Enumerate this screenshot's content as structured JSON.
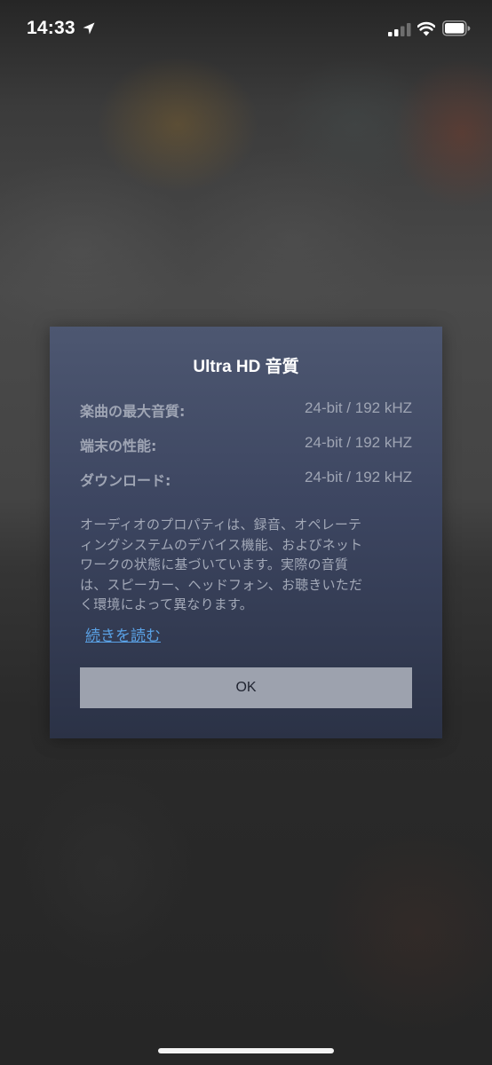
{
  "status_bar": {
    "time": "14:33",
    "icons": [
      "location-arrow-icon",
      "cellular-signal-icon",
      "wifi-icon",
      "battery-icon"
    ]
  },
  "modal": {
    "title": "Ultra HD 音質",
    "specs": [
      {
        "label": "楽曲の最大音質:",
        "value": "24-bit / 192 kHZ"
      },
      {
        "label": "端末の性能:",
        "value": "24-bit / 192 kHZ"
      },
      {
        "label": "ダウンロード:",
        "value": "24-bit / 192 kHZ"
      }
    ],
    "description_lines": [
      "オーディオのプロパティは、録音、オペレーテ",
      "ィングシステムのデバイス機能、およびネット",
      "ワークの状態に基づいています。実際の音質",
      "は、スピーカー、ヘッドフォン、お聴きいただ",
      "く環境によって異なります。"
    ],
    "read_more_label": "続きを読む",
    "ok_label": "OK"
  },
  "colors": {
    "modal_top": "#4d5771",
    "modal_bottom": "#2b3246",
    "link": "#5aa2e6",
    "ok_button": "#9da2ae",
    "muted_text": "#9fa5b4"
  }
}
